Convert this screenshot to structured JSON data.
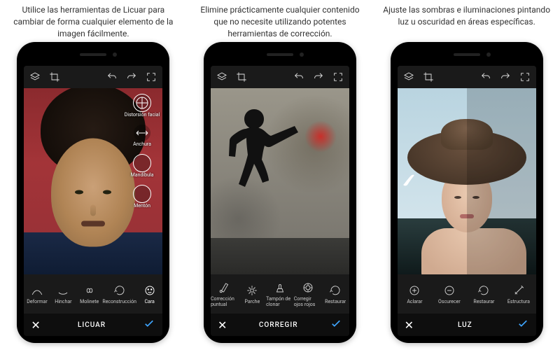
{
  "captions": [
    "Utilice las herramientas de Licuar para cambiar de forma cualquier elemento de la imagen fácilmente.",
    "Elimine prácticamente cualquier contenido que no necesite utilizando potentes herramientas de corrección.",
    "Ajuste las sombras e iluminaciones pintando luz u oscuridad en áreas específicas."
  ],
  "topbar_icons": [
    "layers-icon",
    "crop-icon",
    "undo-icon",
    "redo-icon",
    "fullscreen-icon"
  ],
  "phones": [
    {
      "mode_title": "LICUAR",
      "side_tools": [
        {
          "label": "Distorsión facial",
          "icon": "globe"
        },
        {
          "label": "Anchura",
          "icon": "width"
        },
        {
          "label": "Mandíbula",
          "icon": "jaw"
        },
        {
          "label": "Mentón",
          "icon": "chin"
        }
      ],
      "bottom_tools": [
        {
          "label": "Deformar",
          "icon": "warp"
        },
        {
          "label": "Hinchar",
          "icon": "bloat"
        },
        {
          "label": "Molinete",
          "icon": "twirl"
        },
        {
          "label": "Reconstrucción",
          "icon": "reconstruct"
        },
        {
          "label": "Cara",
          "icon": "face",
          "active": true
        }
      ]
    },
    {
      "mode_title": "CORREGIR",
      "bottom_tools": [
        {
          "label": "Corrección puntual",
          "icon": "spotheal"
        },
        {
          "label": "Parche",
          "icon": "patch"
        },
        {
          "label": "Tampón de clonar",
          "icon": "clone"
        },
        {
          "label": "Corregir ojos rojos",
          "icon": "redeye"
        },
        {
          "label": "Restaurar",
          "icon": "restore"
        }
      ]
    },
    {
      "mode_title": "LUZ",
      "bottom_tools": [
        {
          "label": "Aclarar",
          "icon": "plus"
        },
        {
          "label": "Oscurecer",
          "icon": "minus"
        },
        {
          "label": "Restaurar",
          "icon": "restore"
        },
        {
          "label": "Estructura",
          "icon": "wand"
        }
      ]
    }
  ]
}
